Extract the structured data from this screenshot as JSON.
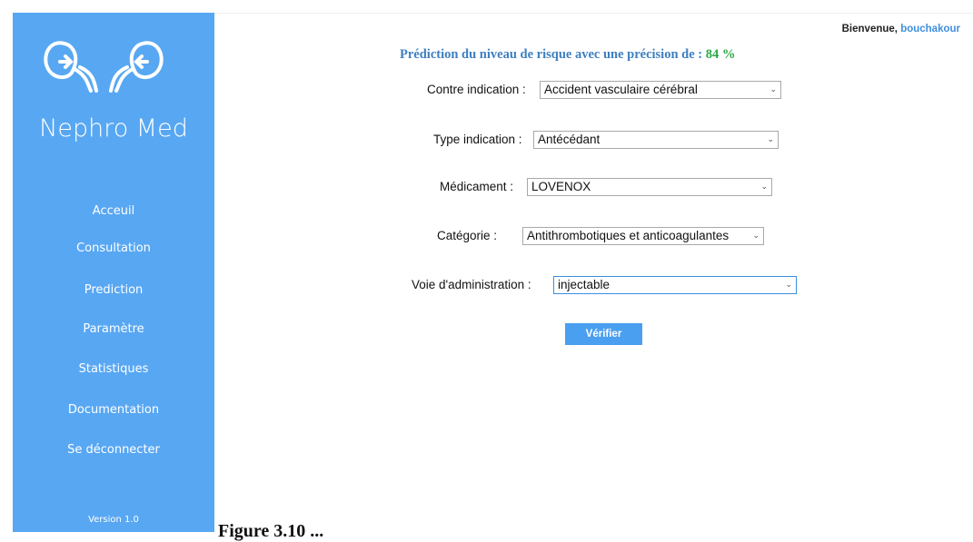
{
  "sidebar": {
    "brand": "Nephro Med",
    "items": [
      {
        "label": "Acceuil"
      },
      {
        "label": "Consultation"
      },
      {
        "label": "Prediction"
      },
      {
        "label": "Paramètre"
      },
      {
        "label": "Statistiques"
      },
      {
        "label": "Documentation"
      },
      {
        "label": "Se déconnecter"
      }
    ],
    "version": "Version 1.0",
    "logo_icon": "kidneys-icon",
    "color": "#58a7f3"
  },
  "header": {
    "welcome_label": "Bienvenue,",
    "username": "bouchakour"
  },
  "main": {
    "heading_text": "Prédiction du niveau de risque  avec une précision de :",
    "accuracy": "84 %",
    "fields": [
      {
        "label": "Contre indication :",
        "value": "Accident vasculaire cérébral"
      },
      {
        "label": "Type indication :",
        "value": "Antécédant"
      },
      {
        "label": "Médicament :",
        "value": "LOVENOX"
      },
      {
        "label": "Catégorie  :",
        "value": "Antithrombotiques et anticoagulantes"
      },
      {
        "label": "Voie d'administration  :",
        "value": "injectable"
      }
    ],
    "submit_label": "Vérifier"
  },
  "caption_fragment": "Figure 3.10 ... ",
  "colors": {
    "accent": "#4a9ff0",
    "accuracy": "#29a845",
    "heading": "#3e7fc2"
  }
}
